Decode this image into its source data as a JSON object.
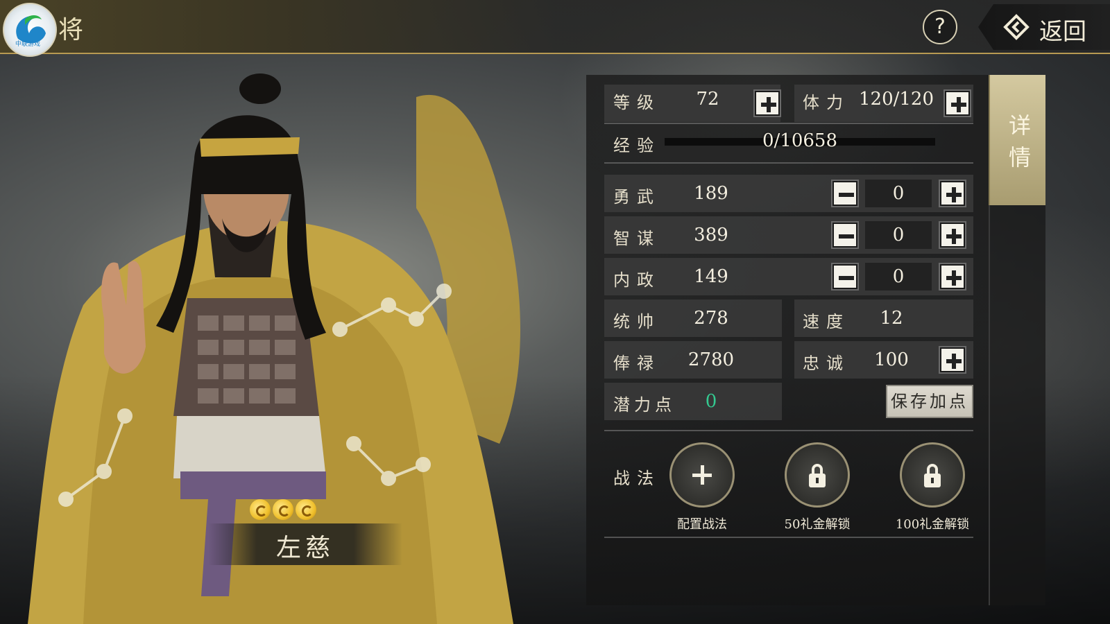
{
  "header": {
    "logo_text": "中联游戏",
    "title": "将",
    "help_label": "?",
    "back_label": "返回"
  },
  "side_tab": {
    "label": "详情"
  },
  "general": {
    "name": "左慈",
    "stars": 3
  },
  "stats": {
    "level": {
      "label": "等级",
      "value": "72"
    },
    "stamina": {
      "label": "体力",
      "value": "120/120"
    },
    "experience": {
      "label": "经验",
      "value": "0/10658",
      "progress": 0
    },
    "valor": {
      "label": "勇武",
      "value": "189",
      "added": "0"
    },
    "strategy": {
      "label": "智谋",
      "value": "389",
      "added": "0"
    },
    "politics": {
      "label": "内政",
      "value": "149",
      "added": "0"
    },
    "command": {
      "label": "统帅",
      "value": "278"
    },
    "speed": {
      "label": "速度",
      "value": "12"
    },
    "salary": {
      "label": "俸禄",
      "value": "2780"
    },
    "loyalty": {
      "label": "忠诚",
      "value": "100"
    },
    "potential": {
      "label": "潜力点",
      "value": "0"
    }
  },
  "save_button": "保存加点",
  "tactics": {
    "label": "战法",
    "slots": [
      {
        "label": "配置战法",
        "icon": "plus-icon"
      },
      {
        "label": "50礼金解锁",
        "icon": "lock-icon"
      },
      {
        "label": "100礼金解锁",
        "icon": "lock-icon"
      }
    ]
  },
  "colors": {
    "accent_gold": "#b89a52",
    "potential_green": "#34c990",
    "robe_yellow": "#c8a840"
  }
}
